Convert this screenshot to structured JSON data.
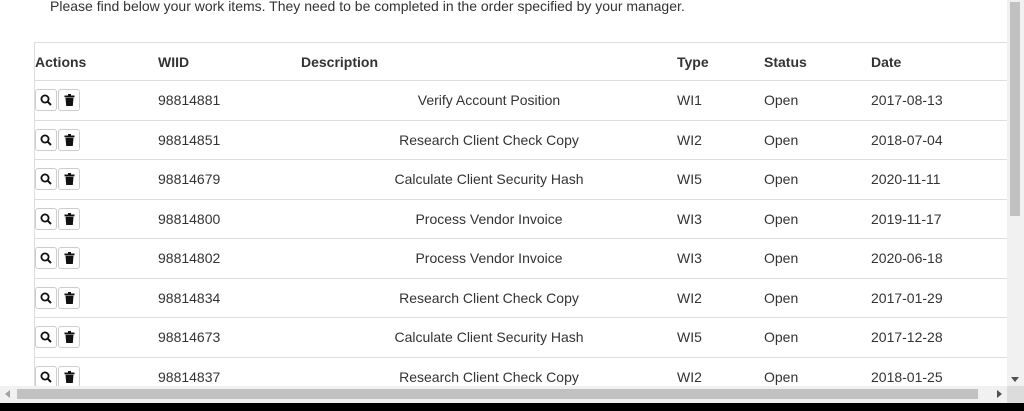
{
  "intro_text": "Please find below your work items. They need to be completed in the order specified by your manager.",
  "table": {
    "headers": {
      "actions": "Actions",
      "wiid": "WIID",
      "description": "Description",
      "type": "Type",
      "status": "Status",
      "date": "Date"
    },
    "rows": [
      {
        "wiid": "98814881",
        "description": "Verify Account Position",
        "type": "WI1",
        "status": "Open",
        "date": "2017-08-13"
      },
      {
        "wiid": "98814851",
        "description": "Research Client Check Copy",
        "type": "WI2",
        "status": "Open",
        "date": "2018-07-04"
      },
      {
        "wiid": "98814679",
        "description": "Calculate Client Security Hash",
        "type": "WI5",
        "status": "Open",
        "date": "2020-11-11"
      },
      {
        "wiid": "98814800",
        "description": "Process Vendor Invoice",
        "type": "WI3",
        "status": "Open",
        "date": "2019-11-17"
      },
      {
        "wiid": "98814802",
        "description": "Process Vendor Invoice",
        "type": "WI3",
        "status": "Open",
        "date": "2020-06-18"
      },
      {
        "wiid": "98814834",
        "description": "Research Client Check Copy",
        "type": "WI2",
        "status": "Open",
        "date": "2017-01-29"
      },
      {
        "wiid": "98814673",
        "description": "Calculate Client Security Hash",
        "type": "WI5",
        "status": "Open",
        "date": "2017-12-28"
      },
      {
        "wiid": "98814837",
        "description": "Research Client Check Copy",
        "type": "WI2",
        "status": "Open",
        "date": "2018-01-25"
      }
    ]
  },
  "icons": {
    "view": "search-icon",
    "delete": "trash-icon"
  },
  "colors": {
    "border": "#dddddd",
    "text": "#333333",
    "scrollbar_track": "#f1f1f1",
    "scrollbar_thumb": "#c1c1c1"
  }
}
